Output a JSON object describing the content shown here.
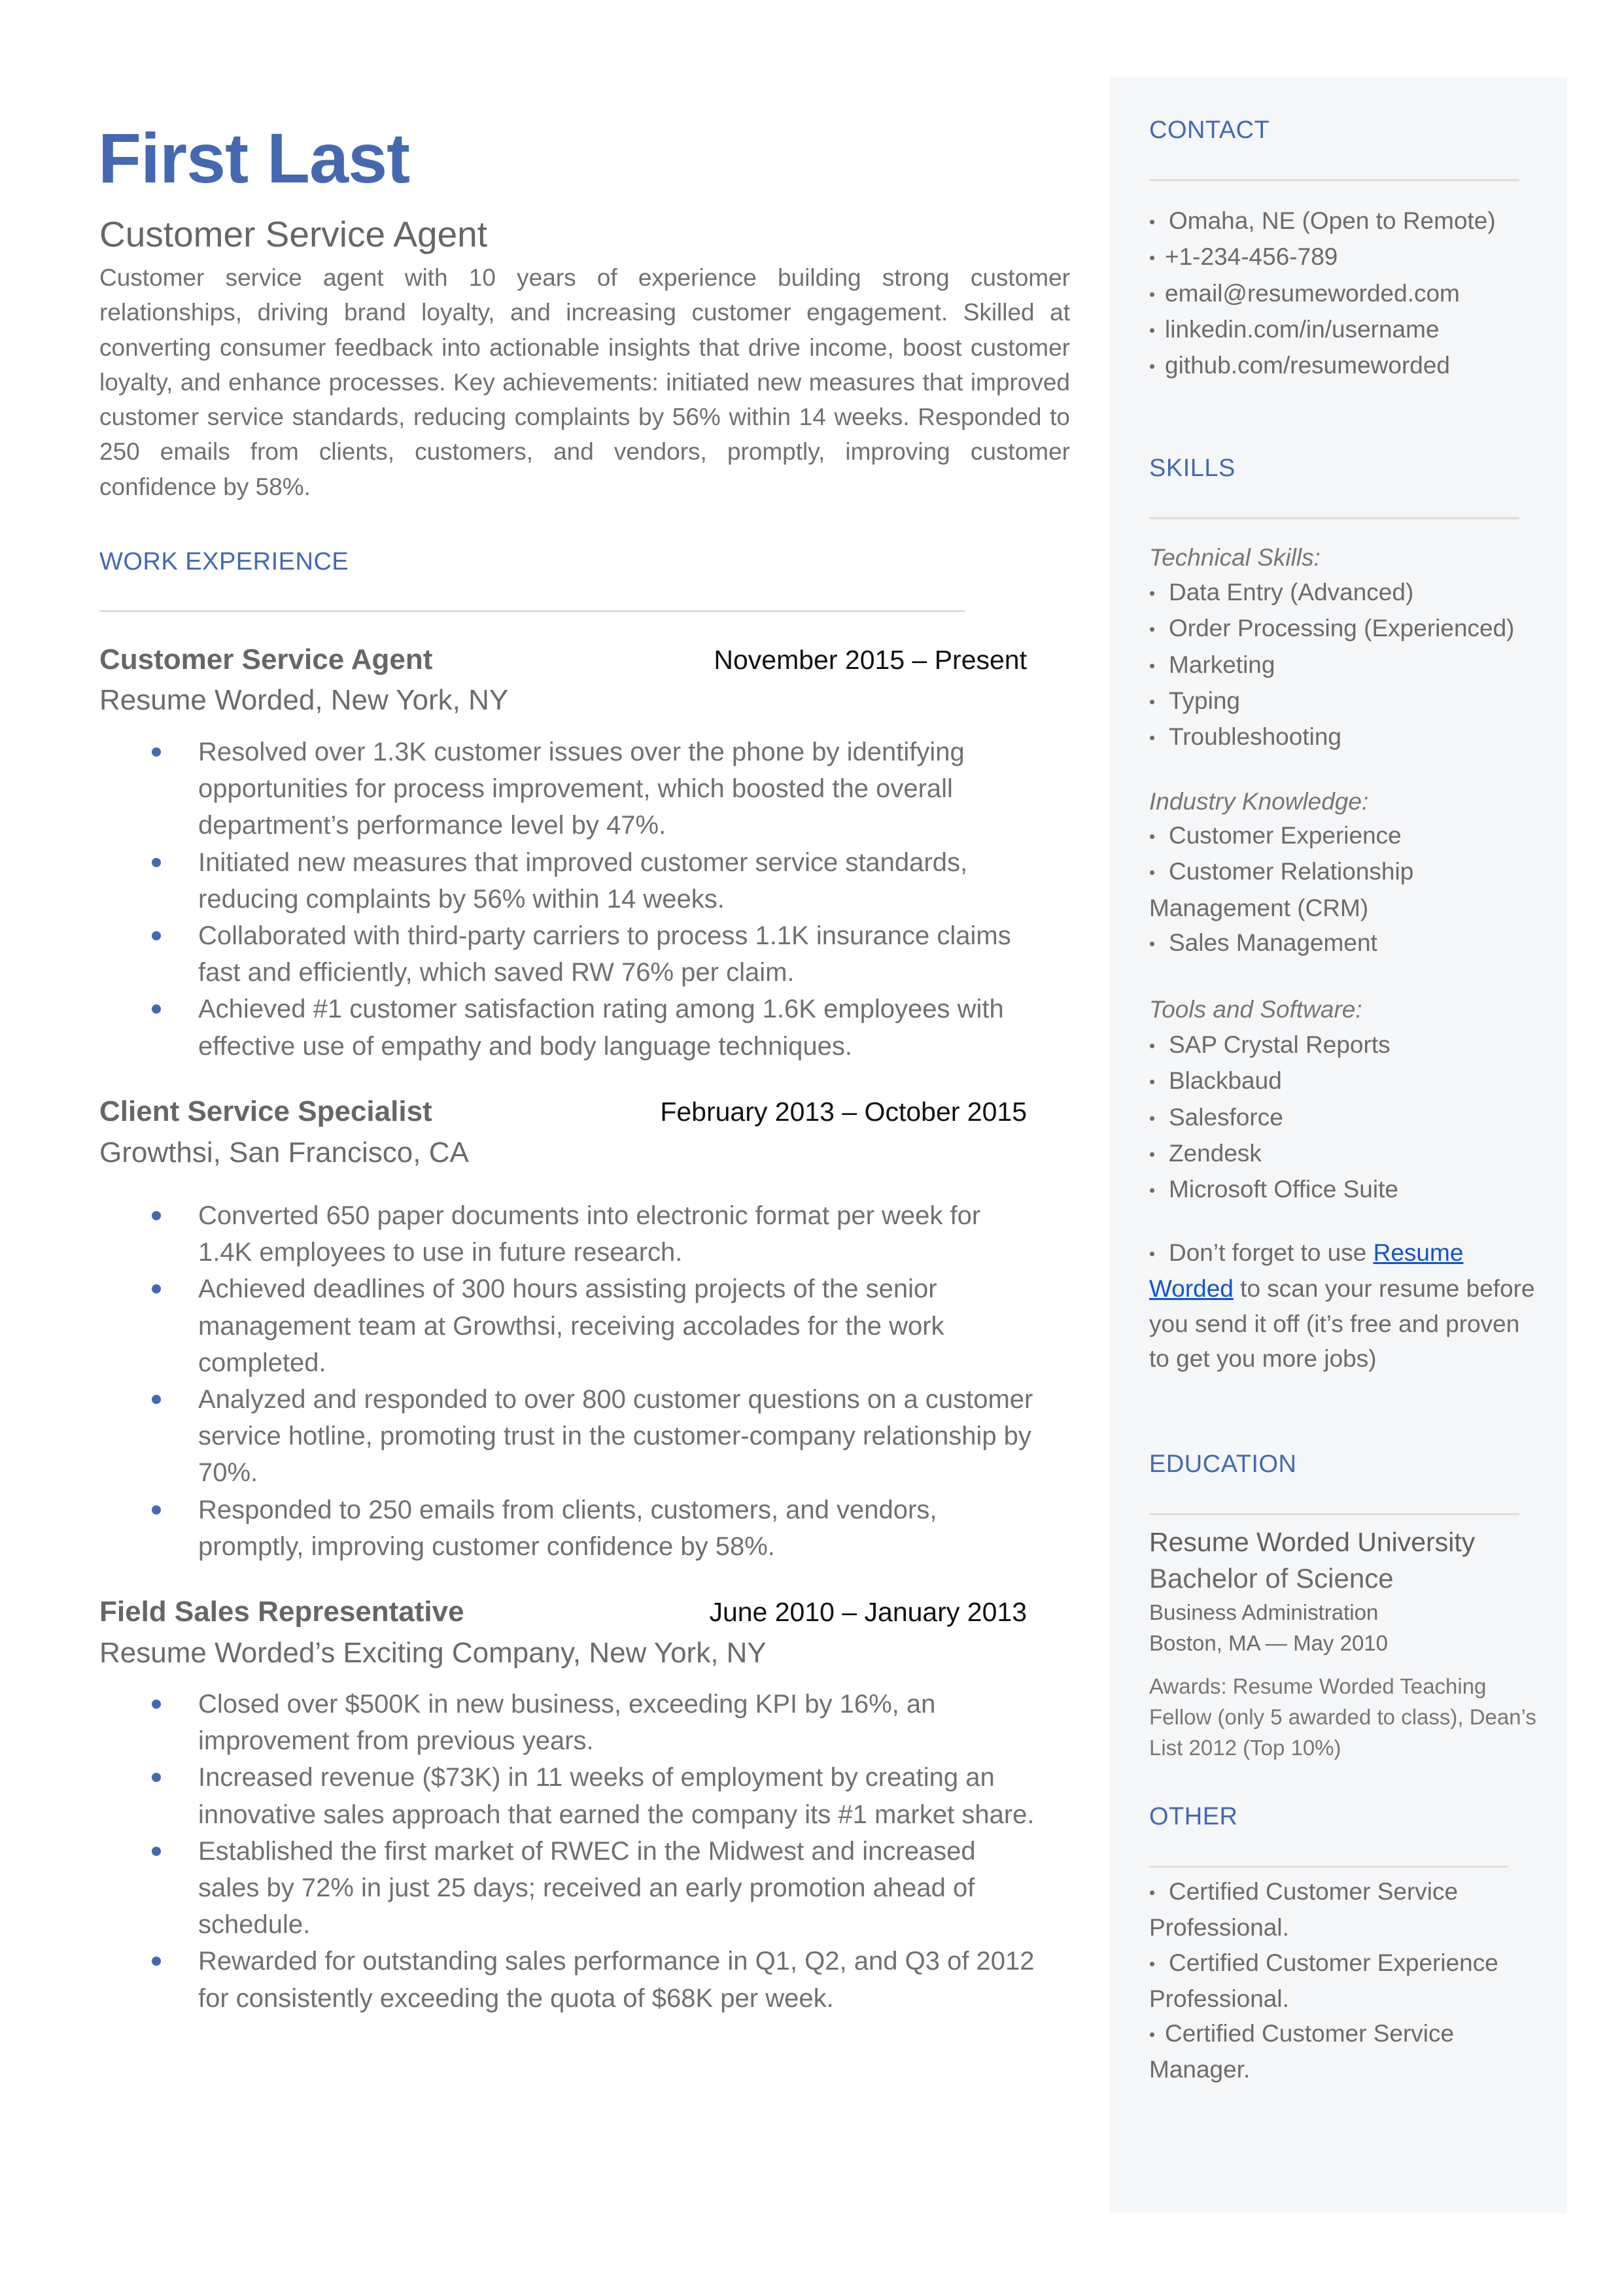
{
  "header": {
    "name": "First Last",
    "title": "Customer Service Agent",
    "summary": "Customer service agent with 10 years of experience building strong customer relationships, driving brand loyalty, and increasing customer engagement. Skilled at converting consumer feedback into actionable insights that drive income, boost customer loyalty, and enhance processes. Key achievements: initiated new measures that improved customer service standards, reducing complaints by 56% within 14 weeks. Responded to 250 emails from clients, customers,  and vendors, promptly, improving customer confidence by 58%."
  },
  "colors": {
    "accent": "#4468b1",
    "text": "#666666",
    "date": "#111111",
    "link": "#1155cc",
    "sidebar_bg": "#f5f6f8",
    "divider": "#dcdcdc"
  },
  "work": {
    "heading": "WORK EXPERIENCE",
    "jobs": [
      {
        "title": "Customer Service Agent",
        "dates": "November 2015 – Present",
        "company": "Resume Worded, New York, NY",
        "bullets": [
          "Resolved over 1.3K customer issues over the phone by identifying opportunities for process improvement, which boosted the overall department’s performance level by 47%.",
          "Initiated new measures that improved customer service standards, reducing complaints by 56% within 14 weeks.",
          "Collaborated with third-party carriers to process 1.1K insurance claims fast and efficiently, which saved RW 76% per claim.",
          "Achieved #1 customer satisfaction rating among 1.6K employees with effective use of empathy and body language techniques."
        ]
      },
      {
        "title": "Client Service Specialist",
        "dates": "February 2013 – October 2015",
        "company": "Growthsi, San Francisco, CA",
        "bullets": [
          "Converted 650 paper documents into electronic format per week for 1.4K employees to use in future research.",
          "Achieved deadlines of 300 hours assisting projects of the senior management team at Growthsi, receiving accolades for the work completed.",
          "Analyzed and responded to over 800 customer questions on a customer service hotline, promoting trust in the customer-company relationship by 70%.",
          "Responded to 250 emails from clients, customers,  and vendors, promptly, improving customer confidence by 58%."
        ]
      },
      {
        "title": "Field Sales Representative",
        "dates": "June 2010 – January 2013",
        "company": "Resume Worded’s Exciting Company, New York, NY",
        "bullets": [
          "Closed over $500K in new business, exceeding KPI by 16%, an improvement from previous years.",
          "Increased revenue ($73K) in 11 weeks of employment by creating an innovative sales approach that earned the company its #1 market share.",
          "Established the first market of RWEC in the Midwest and increased sales by 72% in just 25 days; received an early promotion ahead of schedule.",
          "Rewarded for outstanding sales performance in Q1, Q2, and Q3 of 2012 for consistently exceeding the quota of $68K per week."
        ]
      }
    ]
  },
  "sidebar": {
    "contact": {
      "heading": "CONTACT",
      "items": [
        "Omaha, NE (Open to Remote)",
        "+1-234-456-789",
        "email@resumeworded.com",
        "linkedin.com/in/username",
        "github.com/resumeworded"
      ]
    },
    "skills": {
      "heading": "SKILLS",
      "technical_label": "Technical Skills:",
      "technical": [
        "Data Entry (Advanced)",
        "Order Processing (Experienced)",
        "Marketing",
        "Typing",
        "Troubleshooting"
      ],
      "industry_label": "Industry Knowledge:",
      "industry": [
        "Customer Experience",
        "Customer Relationship Management (CRM)",
        "Sales Management"
      ],
      "tools_label": "Tools and Software:",
      "tools": [
        "SAP Crystal Reports",
        "Blackbaud",
        "Salesforce",
        "Zendesk",
        "Microsoft Office Suite"
      ],
      "note_prefix": "Don’t forget to use ",
      "note_link": "Resume Worded",
      "note_suffix": " to scan your resume before you send it off (it’s free and proven to get you more jobs)"
    },
    "education": {
      "heading": "EDUCATION",
      "school": "Resume Worded University",
      "degree": "Bachelor of Science",
      "major": "Business Administration",
      "location_date": "Boston, MA — May 2010",
      "awards": "Awards: Resume Worded Teaching Fellow (only 5 awarded to class), Dean’s List 2012 (Top 10%)"
    },
    "other": {
      "heading": "OTHER",
      "items": [
        "Certified Customer Service Professional.",
        "Certified Customer Experience Professional.",
        "Certified Customer Service Manager."
      ]
    }
  }
}
